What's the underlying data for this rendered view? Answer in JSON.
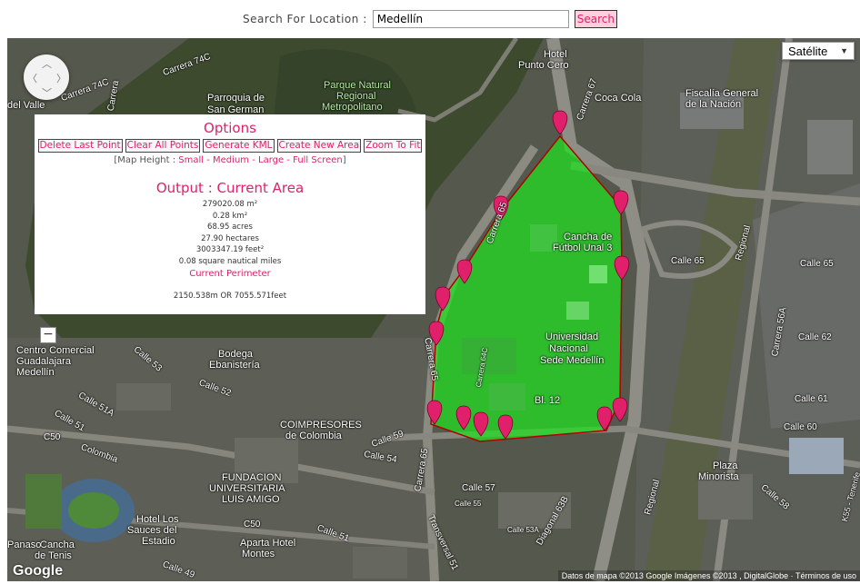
{
  "search": {
    "label": "Search For Location :",
    "value": "Medellín",
    "button_label": "Search"
  },
  "map_type": {
    "selected": "Satélite"
  },
  "options": {
    "title": "Options",
    "buttons": [
      "Delete Last Point",
      "Clear All Points",
      "Generate KML",
      "Create New Area",
      "Zoom To Fit"
    ],
    "map_height": {
      "prefix": "[Map Height : ",
      "small": "Small",
      "medium": "Medium",
      "large": "Large",
      "full": "Full Screen",
      "suffix": "]",
      "sep": " - "
    },
    "output_title": "Output : Current Area",
    "area_lines": [
      "279020.08 m²",
      "0.28 km²",
      "68.95 acres",
      "27.90 hectares",
      "3003347.19 feet²",
      "0.08 square nautical miles"
    ],
    "perimeter_title": "Current Perimeter",
    "perimeter_value": "2150.538m OR 7055.571feet"
  },
  "map_labels": {
    "carrera_74c": "Carrera 74C",
    "carrera_74c_b": "Carrera 74C",
    "carrera": "Carrera",
    "del_valle": "del Valle",
    "parroquia": "Parroquia de",
    "san_german": "San German",
    "parque_1": "Parque Natural",
    "parque_2": "Regional",
    "parque_3": "Metropolitano",
    "hotel": "Hotel",
    "punto_cero": "Punto Cero",
    "carrera_67": "Carrera 67",
    "coca_cola": "Coca Cola",
    "fiscalia_1": "Fiscalía General",
    "fiscalia_2": "de la Nación",
    "cancha_1": "Cancha de",
    "cancha_2": "Fútbol Unal 3",
    "carrera_65_a": "Carrera 65",
    "carrera_65_b": "Carrera 65",
    "carrera_65_c": "Carrera 65",
    "univ_1": "Universidad",
    "univ_2": "Nacional",
    "univ_3": "Sede Medellín",
    "bl12": "Bl. 12",
    "carrera_64c": "Carrera 64C",
    "regional_a": "Regional",
    "regional_b": "Regional",
    "calle_65": "Calle 65",
    "calle_62": "Calle 62",
    "carrera_56a": "Carrera 56A",
    "calle_61": "Calle 61",
    "calle_60": "Calle 60",
    "cc_1": "Centro Comercial",
    "cc_2": "Guadalajara",
    "cc_3": "Medellín",
    "calle_53": "Calle 53",
    "bodega_1": "Bodega",
    "bodega_2": "Ebanistería",
    "calle_52": "Calle 52",
    "calle_51a": "Calle 51A",
    "calle_51b": "Calle 51",
    "c50_a": "C50",
    "colombia": "Colombia",
    "coimpresores_1": "COIMPRESORES",
    "coimpresores_2": "de Colombia",
    "calle_59": "Calle 59",
    "calle_54": "Calle 54",
    "calle_57": "Calle 57",
    "calle_55": "Calle 55",
    "diagonal_63b": "Diagonal 63B",
    "calle_53a": "Calle 53A",
    "calle_51c": "Calle 51",
    "fundacion_1": "FUNDACION",
    "fundacion_2": "UNIVERSITARIA",
    "fundacion_3": "LUIS AMIGO",
    "c50_b": "C50",
    "hotel_los_1": "Hotel Los",
    "hotel_los_2": "Sauces del",
    "hotel_los_3": "Estadio",
    "aparta_1": "Aparta Hotel",
    "aparta_2": "Montes",
    "calle_49": "Calle 49",
    "transversal": "Transversal 51",
    "cancha_tenis_1": "Cancha",
    "cancha_tenis_2": "de Tenis",
    "panaso": "Panaso",
    "plaza_1": "Plaza",
    "plaza_2": "Minorista",
    "calle_58": "Calle 58",
    "k55": "K55 - Tenerife",
    "calle_65b": "Calle 65"
  },
  "google_logo": "Google",
  "attribution": "Datos de mapa ©2013 Google Imágenes ©2013 , DigitalGlobe · Términos de uso",
  "colors": {
    "accent": "#e0206a",
    "polygon_fill": "#22dd22",
    "polygon_stroke": "#b00000",
    "marker": "#e0206a"
  }
}
